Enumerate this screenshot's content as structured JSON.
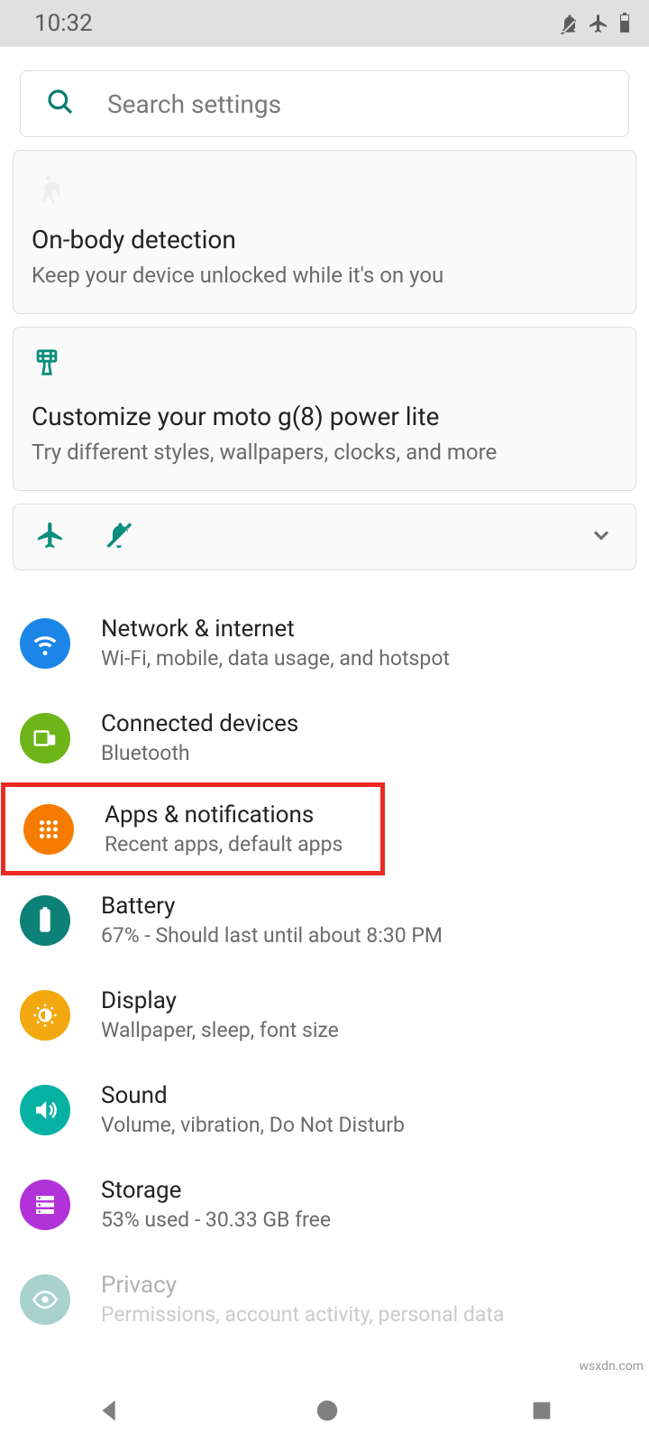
{
  "status": {
    "time": "10:32"
  },
  "search": {
    "placeholder": "Search settings"
  },
  "cards": {
    "onbody": {
      "title": "On-body detection",
      "sub": "Keep your device unlocked while it's on you"
    },
    "customize": {
      "title": "Customize your moto g(8) power lite",
      "sub": "Try different styles, wallpapers, clocks, and more"
    }
  },
  "rows": {
    "network": {
      "title": "Network & internet",
      "sub": "Wi-Fi, mobile, data usage, and hotspot",
      "color": "#1c85e8"
    },
    "devices": {
      "title": "Connected devices",
      "sub": "Bluetooth",
      "color": "#6db518"
    },
    "apps": {
      "title": "Apps & notifications",
      "sub": "Recent apps, default apps",
      "color": "#f57c00"
    },
    "battery": {
      "title": "Battery",
      "sub": "67% - Should last until about 8:30 PM",
      "color": "#0d8077"
    },
    "display": {
      "title": "Display",
      "sub": "Wallpaper, sleep, font size",
      "color": "#f2a80e"
    },
    "sound": {
      "title": "Sound",
      "sub": "Volume, vibration, Do Not Disturb",
      "color": "#05B1A3"
    },
    "storage": {
      "title": "Storage",
      "sub": "53% used - 30.33 GB free",
      "color": "#b032d8"
    },
    "privacy": {
      "title": "Privacy",
      "sub": "Permissions, account activity, personal data",
      "color": "#0d8077"
    }
  },
  "watermark": "wsxdn.com"
}
